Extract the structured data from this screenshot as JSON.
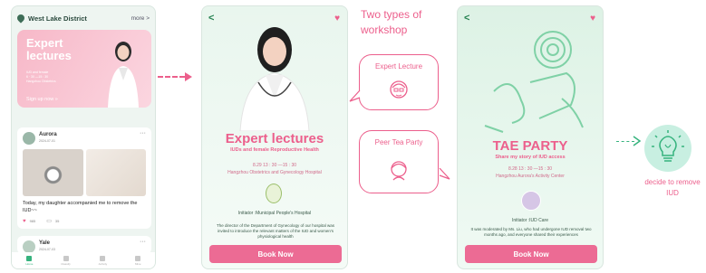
{
  "phone1": {
    "location": "West Lake District",
    "more": "more >",
    "banner": {
      "title_line1": "Expert",
      "title_line2": "lectures",
      "small_line1": "IUD and female",
      "small_line2": "6 · 30 —15 : 30",
      "small_line3": "Hangzhou Obstetrics",
      "signup": "Sign up now »"
    },
    "post1": {
      "name": "Aurora",
      "date": "2024-07-01",
      "text": "Today, my daughter accompanied me to remove the IUD~~",
      "likes": "985",
      "comments": "35"
    },
    "post2": {
      "name": "Yale",
      "date": "2024-07-03"
    },
    "tabs": [
      "Home",
      "Classify",
      "Activity",
      "Mine"
    ]
  },
  "phone2": {
    "title": "Expert lectures",
    "subtitle": "IUDs and female Reproductive Health",
    "time": "8.29 13 : 30 —15 : 30",
    "place": "Hangzhou Obstetrics and Gynecology Hospital",
    "initiator": "Initiator :Municipal People's Hospital",
    "description": "The director of the Department of Gynecology of our hospital was invited to introduce the relevant matters of the IUD and women's physiological health",
    "book": "Book Now"
  },
  "middle": {
    "title": "Two types of workshop",
    "bubble1": "Expert  Lecture",
    "bubble2": "Peer Tea Party"
  },
  "phone3": {
    "title": "TAE PARTY",
    "subtitle": "Share my story of IUD access",
    "time": "8.28 13 : 30 —15 : 30",
    "place": "Hangzhou Aurora's Activity Center",
    "initiator": "Initiator :IUD Care",
    "description": "It was moderated by Ms. Liu, who had undergone IUD removal two months ago, and everyone shared their experiences",
    "book": "Book Now"
  },
  "outcome": {
    "text": "decide to remove  IUD"
  },
  "colors": {
    "accent_pink": "#ec5f8c",
    "accent_green": "#36b37e"
  }
}
